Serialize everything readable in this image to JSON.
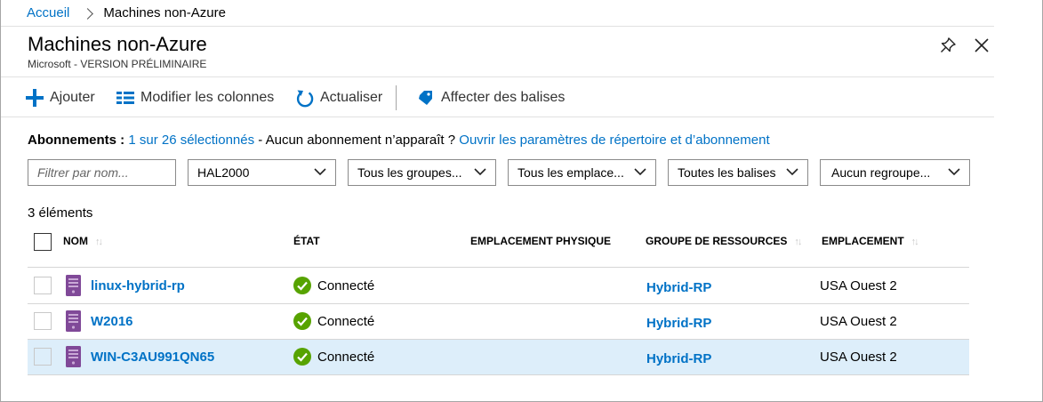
{
  "breadcrumb": {
    "home": "Accueil",
    "current": "Machines non-Azure"
  },
  "header": {
    "title": "Machines non-Azure",
    "subtitle": "Microsoft - VERSION PRÉLIMINAIRE",
    "pin_icon": "pin-icon",
    "close_icon": "close-icon"
  },
  "toolbar": {
    "add": "Ajouter",
    "edit_columns": "Modifier les colonnes",
    "refresh": "Actualiser",
    "assign_tags": "Affecter des balises"
  },
  "subscriptions": {
    "label": "Abonnements :",
    "selected": "1 sur 26 sélectionnés",
    "middle": " - Aucun abonnement n’apparaît ? ",
    "link": "Ouvrir les paramètres de répertoire et d’abonnement"
  },
  "filters": {
    "name_placeholder": "Filtrer par nom...",
    "subscription": "HAL2000",
    "groups": "Tous les groupes...",
    "locations": "Tous les emplace...",
    "tags": "Toutes les balises",
    "grouping": "Aucun regroupe..."
  },
  "count": "3 éléments",
  "columns": {
    "name": "NOM",
    "state": "ÉTAT",
    "physical_location": "EMPLACEMENT PHYSIQUE",
    "resource_group": "GROUPE DE RESSOURCES",
    "location": "EMPLACEMENT"
  },
  "rows": [
    {
      "name": "linux-hybrid-rp",
      "state": "Connecté",
      "physical_location": "",
      "resource_group": "Hybrid-RP",
      "location": "USA Ouest 2"
    },
    {
      "name": "W2016",
      "state": "Connecté",
      "physical_location": "",
      "resource_group": "Hybrid-RP",
      "location": "USA Ouest 2"
    },
    {
      "name": "WIN-C3AU991QN65",
      "state": "Connecté",
      "physical_location": "",
      "resource_group": "Hybrid-RP",
      "location": "USA Ouest 2"
    }
  ],
  "colors": {
    "link": "#0072c6",
    "selected_row": "#ddeefa",
    "status_ok": "#57a300",
    "vm_icon": "#804998"
  }
}
